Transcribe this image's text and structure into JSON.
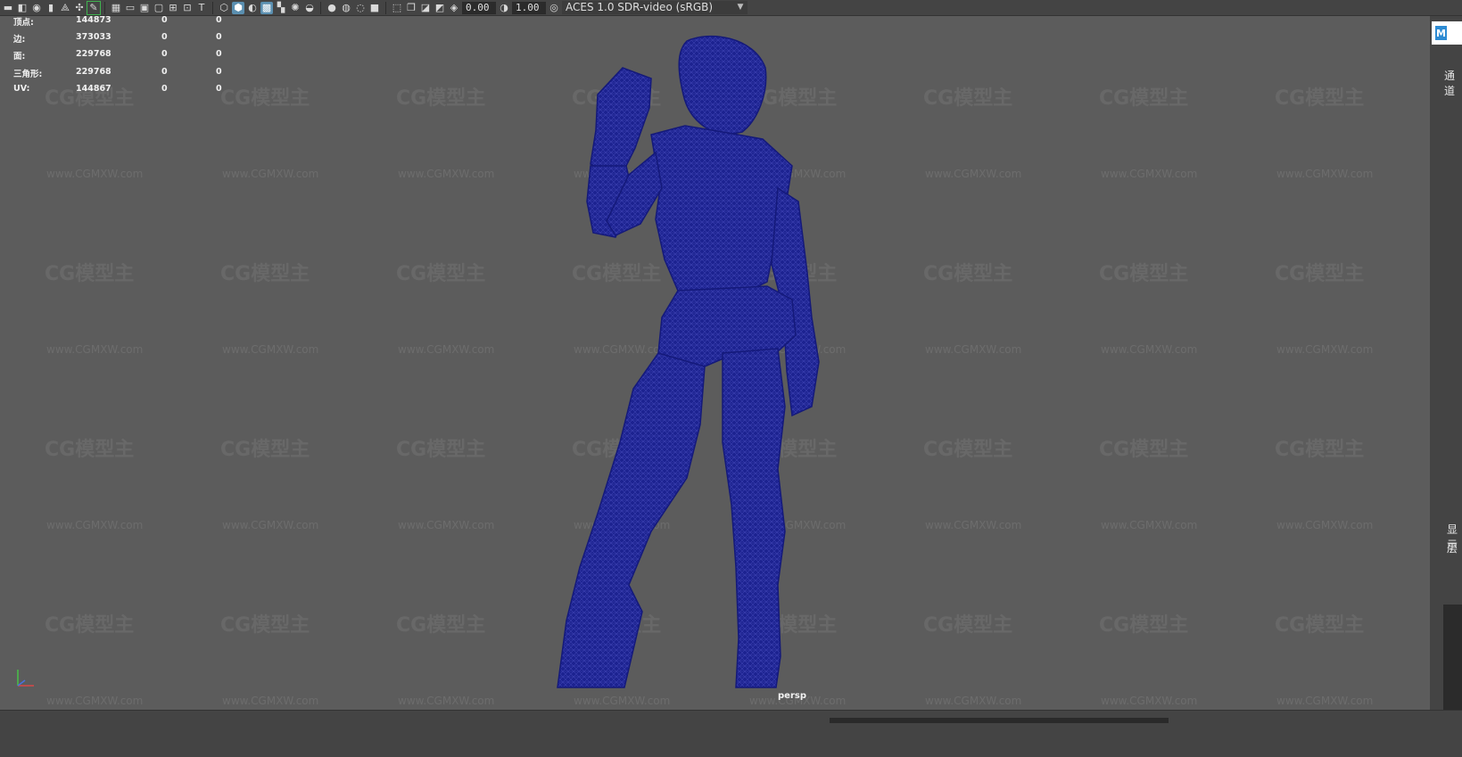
{
  "toolbar": {
    "exposure_value": "0.00",
    "gamma_value": "1.00",
    "color_space": "ACES 1.0 SDR-video (sRGB)",
    "icons": [
      "camera-icon",
      "camera-attr-icon",
      "bookmark-icon",
      "image-plane-icon",
      "grid-icon",
      "film-gate-icon",
      "resolution-gate-icon",
      "gate-mask-icon",
      "field-chart-icon",
      "safe-action-icon",
      "safe-title-icon",
      "wireframe-icon",
      "smooth-shade-icon",
      "default-material-icon",
      "textured-icon",
      "lights-icon",
      "shadows-icon",
      "ambient-occlusion-icon",
      "motion-blur-icon",
      "anti-aliasing-icon",
      "depth-of-field-icon",
      "isolate-select-icon",
      "xray-icon",
      "xray-joints-icon",
      "backface-icon",
      "exposure-icon",
      "gamma-icon",
      "color-management-icon"
    ]
  },
  "hud": {
    "rows": [
      {
        "label": "顶点:",
        "v1": "144873",
        "v2": "0",
        "v3": "0"
      },
      {
        "label": "边:",
        "v1": "373033",
        "v2": "0",
        "v3": "0"
      },
      {
        "label": "面:",
        "v1": "229768",
        "v2": "0",
        "v3": "0"
      },
      {
        "label": "三角形:",
        "v1": "229768",
        "v2": "0",
        "v3": "0"
      },
      {
        "label": "UV:",
        "v1": "144867",
        "v2": "0",
        "v3": "0"
      }
    ]
  },
  "viewport": {
    "camera_label": "persp",
    "mesh_color": "#1a1f9a",
    "background": "#5c5c5c"
  },
  "watermark": {
    "logo": "CG模型主",
    "url": "www.CGMXW.com"
  },
  "right_panel": {
    "label_top": "通道",
    "label_display": "显示",
    "label_layer": "层"
  }
}
